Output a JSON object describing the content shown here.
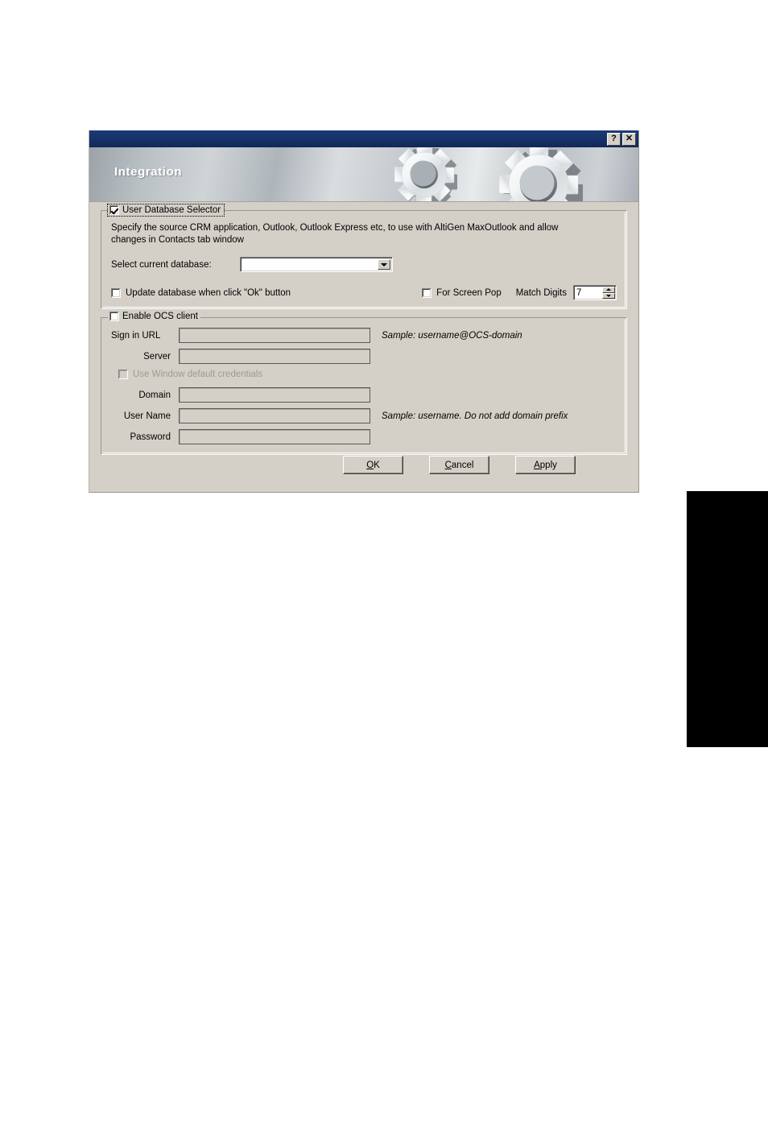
{
  "window": {
    "banner_title": "Integration",
    "help_button": "?",
    "close_button": "✕"
  },
  "user_database_group": {
    "legend": "User Database Selector",
    "legend_checked": true,
    "description": "Specify the source CRM application, Outlook, Outlook Express etc, to use with AltiGen MaxOutlook and allow changes in Contacts tab window",
    "select_label": "Select current database:",
    "select_value": "",
    "update_db_label": "Update database when click \"Ok\" button",
    "update_db_checked": false,
    "screen_pop_label": "For Screen Pop",
    "screen_pop_checked": false,
    "match_digits_label": "Match Digits",
    "match_digits_value": "7"
  },
  "ocs_group": {
    "legend": "Enable OCS client",
    "legend_checked": false,
    "fields": [
      {
        "label": "Sign in URL",
        "value": "",
        "sample": "Sample: username@OCS-domain"
      },
      {
        "label": "Server",
        "value": "",
        "sample": ""
      },
      {
        "label": "Domain",
        "value": "",
        "sample": ""
      },
      {
        "label": "User Name",
        "value": "",
        "sample": "Sample: username. Do not add domain prefix"
      },
      {
        "label": "Password",
        "value": "",
        "sample": ""
      }
    ],
    "default_credentials_label": "Use Window default credentials",
    "default_credentials_checked": false,
    "default_credentials_disabled": true
  },
  "buttons": {
    "ok_mnemonic": "O",
    "ok_rest": "K",
    "cancel_mnemonic": "C",
    "cancel_rest": "ancel",
    "apply_mnemonic": "A",
    "apply_rest": "pply"
  },
  "colors": {
    "titlebar": "#163167",
    "dialog_face": "#d4d0c8",
    "field_border": "#5a5a5a"
  }
}
